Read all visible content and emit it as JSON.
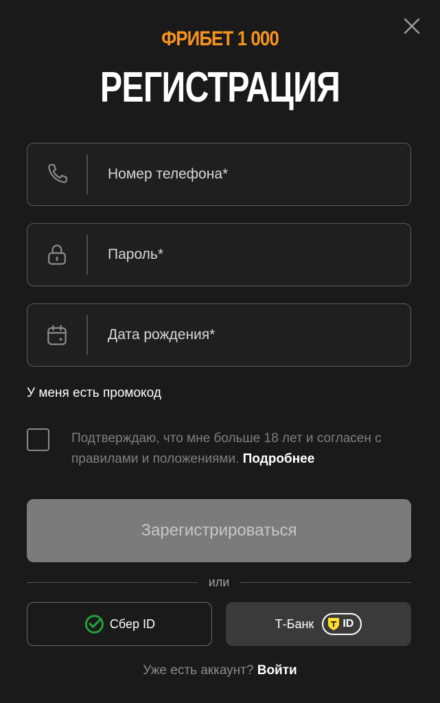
{
  "brand": "ФРИБЕТ 1 000",
  "title": "РЕГИСТРАЦИЯ",
  "fields": {
    "phone": {
      "placeholder": "Номер телефона*",
      "value": "",
      "icon": "phone-icon"
    },
    "password": {
      "placeholder": "Пароль*",
      "value": "",
      "icon": "lock-icon"
    },
    "birthdate": {
      "placeholder": "Дата рождения*",
      "value": "",
      "icon": "calendar-icon"
    }
  },
  "promo_link": "У меня есть промокод",
  "agreement": {
    "text": "Подтверждаю, что мне больше 18 лет и согласен с правилами и положениями.",
    "more_link": "Подробнее",
    "checked": false
  },
  "submit_label": "Зарегистрироваться",
  "divider_text": "или",
  "social": {
    "sber_label": "Сбер ID",
    "tbank_label": "Т-Банк",
    "tbank_id": "ID"
  },
  "footer": {
    "question": "Уже есть аккаунт?",
    "login_link": "Войти"
  },
  "colors": {
    "background": "#1a1a1a",
    "brand_accent": "#f7941d",
    "sber_green": "#21a038",
    "tbank_yellow": "#ffdd2d",
    "submit_disabled": "#7b7b7b"
  }
}
